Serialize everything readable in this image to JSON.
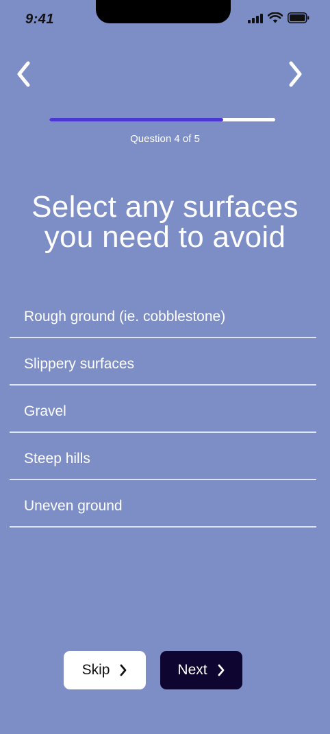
{
  "status_bar": {
    "time": "9:41"
  },
  "icons": {
    "back": "chevron-left-icon",
    "forward": "chevron-right-icon",
    "signal": "signal-icon",
    "wifi": "wifi-icon",
    "battery": "battery-icon"
  },
  "progress": {
    "label": "Question 4 of 5",
    "value": 0.77
  },
  "question": {
    "title_line1": "Select any surfaces",
    "title_line2": "you need to avoid"
  },
  "options": [
    {
      "label": "Rough ground (ie. cobblestone)"
    },
    {
      "label": "Slippery surfaces"
    },
    {
      "label": "Gravel"
    },
    {
      "label": "Steep hills"
    },
    {
      "label": "Uneven ground"
    }
  ],
  "actions": {
    "skip_label": "Skip",
    "next_label": "Next"
  },
  "colors": {
    "background": "#7d8ec7",
    "progress_fill": "#4b38d2",
    "next_button": "#0e0630",
    "skip_button": "#ffffff"
  }
}
